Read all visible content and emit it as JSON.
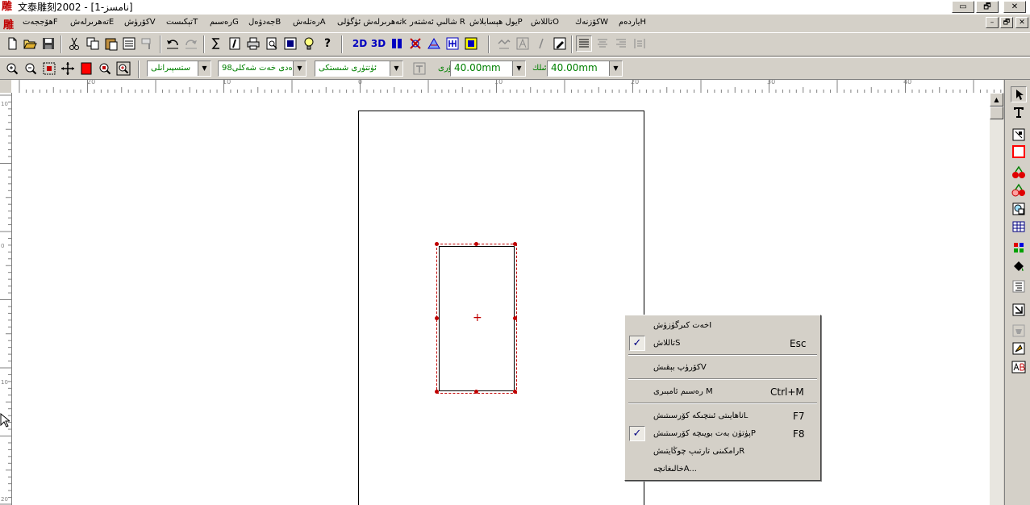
{
  "window": {
    "logo": "雕",
    "title": "文泰雕刻2002 - [نامسز-1]",
    "minimize": "▭",
    "restore": "🗗",
    "close": "✕"
  },
  "menu": {
    "logo": "雕",
    "items": [
      "ھۆججەتF",
      "تەھرىرلەشE",
      "كۆرۈشV",
      "تېكىستT",
      "رەسىمG",
      "جەدۋەلB",
      "رەتلەشA",
      "تەھرىرلەش ئۈگۈلىk",
      "شالىي ئەشتەر R",
      "يول ھېسابلاشP",
      "تاللاشO",
      "كۆزنەكW",
      "ياردەمH"
    ],
    "mdi_min": "–",
    "mdi_restore": "🗗",
    "mdi_close": "✕"
  },
  "toolbar1": {
    "icons": [
      "new-file-icon",
      "open-folder-icon",
      "save-icon",
      "cut-icon",
      "copy-icon",
      "paste-icon",
      "paste-special-icon",
      "format-paint-icon",
      "undo-icon",
      "redo-icon",
      "sigma-icon",
      "italic-box-icon",
      "print-icon",
      "print-preview-icon",
      "frame-icon",
      "bulb-icon",
      "help-icon",
      "2d-icon",
      "3d-icon",
      "carve-icon",
      "pattern-icon",
      "texture-icon",
      "engrave-icon",
      "layout-icon",
      "draw-line-icon",
      "text-a-icon",
      "italic-i-icon",
      "edit-box-icon",
      "align-justify-icon",
      "align-center-icon",
      "align-right-icon",
      "align-distribute-icon"
    ],
    "labels": {
      "d2": "2D",
      "d3": "3D",
      "help": "?"
    }
  },
  "toolbar2": {
    "layer_combo": "ستسپىرانلى",
    "font_combo": "98ئادەدى خەت شەكلى",
    "style_combo": "ئۈتتۈرى شىستكى",
    "width_label": "قۇرى",
    "width_value": "40.00mm",
    "height_label": "ئىلك",
    "height_value": "40.00mm"
  },
  "ruler": {
    "h_labels": [
      "20",
      "10",
      "0",
      "10",
      "20",
      "30",
      "40"
    ],
    "v_labels": [
      "10",
      "0",
      "10",
      "20"
    ]
  },
  "toolbox": {
    "icons": [
      "select-arrow-icon",
      "text-tool-icon",
      "node-edit-icon",
      "rectangle-icon",
      "fruit-icon",
      "fruit-outline-icon",
      "shape-icon",
      "table-icon",
      "color-grid-icon",
      "fill-bucket-icon",
      "paragraph-icon",
      "erase-icon",
      "stamp-icon",
      "text-ab-icon"
    ]
  },
  "context_menu": {
    "items": [
      {
        "label": "خەت كىرگۈزۈشI",
        "shortcut": "",
        "checked": false
      },
      {
        "label": "تاللاشS",
        "shortcut": "Esc",
        "checked": true
      },
      {
        "label": "كۆرۈپ بېقىشV",
        "shortcut": "",
        "checked": false
      },
      {
        "label": "رەسىم ئامبىرى M",
        "shortcut": "Ctrl+M",
        "checked": false
      },
      {
        "label": "ناھايىتى ئىنچىكە كۆرسىتىشL",
        "shortcut": "F7",
        "checked": false
      },
      {
        "label": "پۈتۈن بەت بويىچە كۆرسىتىشP",
        "shortcut": "F8",
        "checked": true
      },
      {
        "label": "رامكىنى تارتىپ چوڭايتىشR",
        "shortcut": "",
        "checked": false
      },
      {
        "label": "خالىغانچەA...",
        "shortcut": "",
        "checked": false
      }
    ],
    "check_glyph": "✓"
  },
  "colors": {
    "selection": "#c00000",
    "accent_green": "#008000",
    "face": "#d4d0c8"
  }
}
